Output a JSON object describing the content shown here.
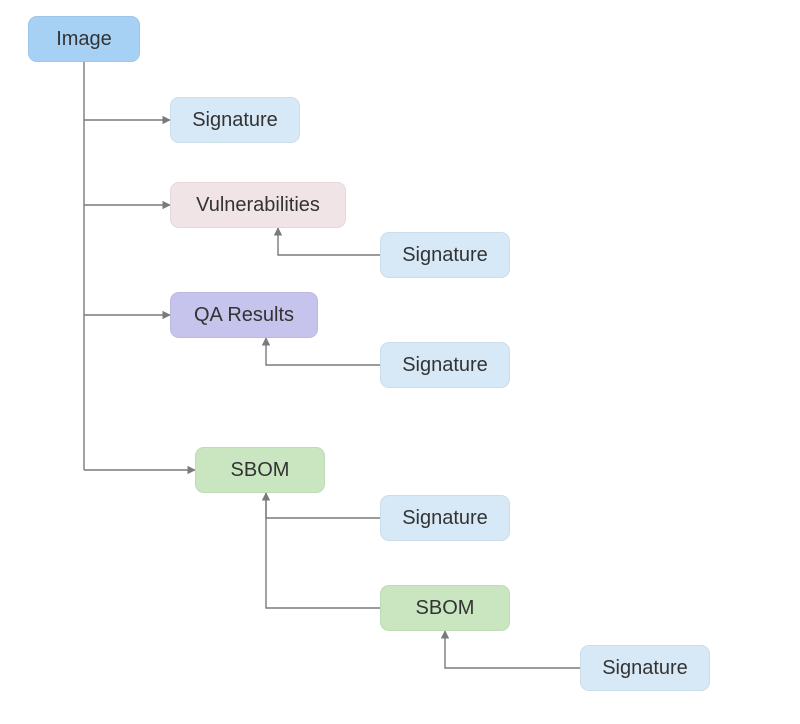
{
  "nodes": {
    "image": {
      "label": "Image",
      "bg": "#a6d1f5"
    },
    "sig1": {
      "label": "Signature",
      "bg": "#d7e9f7"
    },
    "vulnerabilities": {
      "label": "Vulnerabilities",
      "bg": "#f0e4e7"
    },
    "sig2": {
      "label": "Signature",
      "bg": "#d7e9f7"
    },
    "qa": {
      "label": "QA Results",
      "bg": "#c6c3ec"
    },
    "sig3": {
      "label": "Signature",
      "bg": "#d7e9f7"
    },
    "sbom1": {
      "label": "SBOM",
      "bg": "#c9e6c0"
    },
    "sig4": {
      "label": "Signature",
      "bg": "#d7e9f7"
    },
    "sbom2": {
      "label": "SBOM",
      "bg": "#c9e6c0"
    },
    "sig5": {
      "label": "Signature",
      "bg": "#d7e9f7"
    }
  },
  "chart_data": {
    "type": "tree",
    "title": "",
    "root": "Image",
    "children": {
      "Image": [
        "Signature",
        "Vulnerabilities",
        "QA Results",
        "SBOM"
      ],
      "Vulnerabilities": [
        "Signature"
      ],
      "QA Results": [
        "Signature"
      ],
      "SBOM": [
        "Signature",
        "SBOM"
      ],
      "SBOM (nested)": [
        "Signature"
      ]
    },
    "color_key": {
      "Image": "#a6d1f5",
      "Signature": "#d7e9f7",
      "Vulnerabilities": "#f0e4e7",
      "QA Results": "#c6c3ec",
      "SBOM": "#c9e6c0"
    }
  }
}
